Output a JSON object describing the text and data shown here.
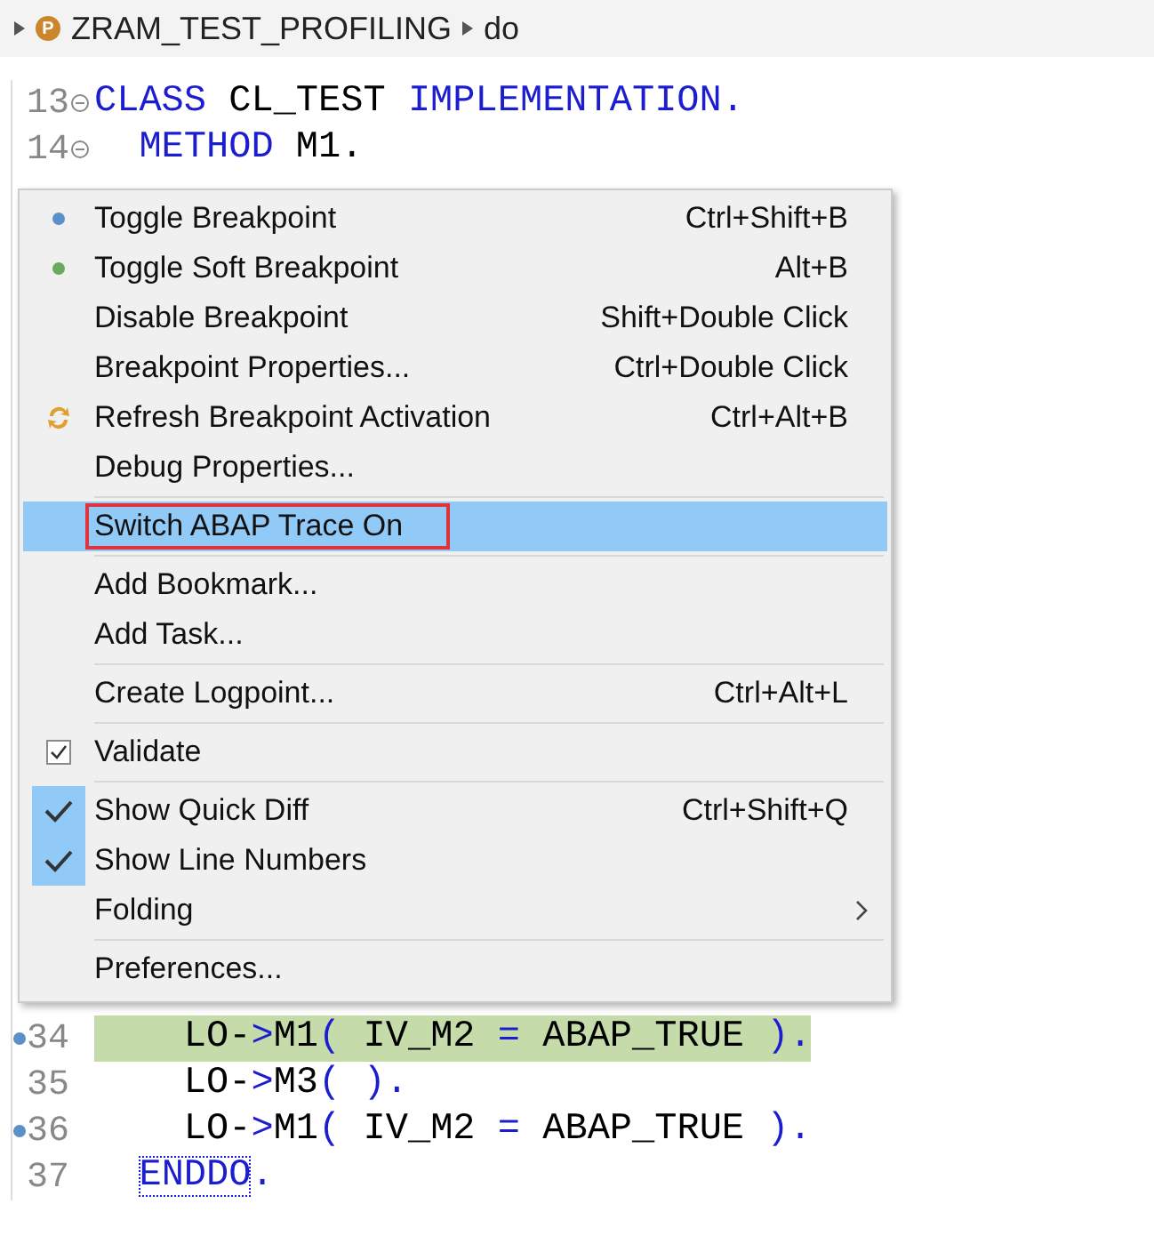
{
  "breadcrumb": {
    "badge": "P",
    "items": [
      "ZRAM_TEST_PROFILING",
      "do"
    ]
  },
  "editor": {
    "top_lines": [
      {
        "number": "13",
        "fold": true,
        "tokens": [
          {
            "kind": "keyword",
            "text": "CLASS "
          },
          {
            "kind": "plain",
            "text": "CL_TEST "
          },
          {
            "kind": "keyword",
            "text": "IMPLEMENTATION."
          }
        ]
      },
      {
        "number": "14",
        "fold": true,
        "tokens": [
          {
            "kind": "keyword",
            "text": "  METHOD "
          },
          {
            "kind": "plain",
            "text": "M1."
          }
        ]
      }
    ],
    "bottom_lines": [
      {
        "number": "34",
        "breakpoint": true,
        "current": true,
        "tokens": [
          {
            "kind": "plain",
            "text": "    LO-"
          },
          {
            "kind": "keyword",
            "text": ">"
          },
          {
            "kind": "plain",
            "text": "M1"
          },
          {
            "kind": "keyword",
            "text": "( "
          },
          {
            "kind": "plain",
            "text": "IV_M2 "
          },
          {
            "kind": "keyword",
            "text": "= "
          },
          {
            "kind": "plain",
            "text": "ABAP_TRUE "
          },
          {
            "kind": "keyword",
            "text": ")."
          }
        ]
      },
      {
        "number": "35",
        "tokens": [
          {
            "kind": "plain",
            "text": "    LO-"
          },
          {
            "kind": "keyword",
            "text": ">"
          },
          {
            "kind": "plain",
            "text": "M3"
          },
          {
            "kind": "keyword",
            "text": "( )."
          }
        ]
      },
      {
        "number": "36",
        "breakpoint": true,
        "tokens": [
          {
            "kind": "plain",
            "text": "    LO-"
          },
          {
            "kind": "keyword",
            "text": ">"
          },
          {
            "kind": "plain",
            "text": "M1"
          },
          {
            "kind": "keyword",
            "text": "( "
          },
          {
            "kind": "plain",
            "text": "IV_M2 "
          },
          {
            "kind": "keyword",
            "text": "= "
          },
          {
            "kind": "plain",
            "text": "ABAP_TRUE "
          },
          {
            "kind": "keyword",
            "text": ")."
          }
        ]
      },
      {
        "number": "37",
        "tokens": [
          {
            "kind": "bracket-match",
            "text": "  ENDDO"
          },
          {
            "kind": "keyword",
            "text": "."
          }
        ]
      }
    ]
  },
  "context_menu": {
    "items": [
      {
        "kind": "dot-action",
        "color": "#5b8fc7",
        "label": "Toggle Breakpoint",
        "shortcut": "Ctrl+Shift+B",
        "selected": false
      },
      {
        "kind": "dot-action",
        "color": "#6aaa5a",
        "label": "Toggle Soft Breakpoint",
        "shortcut": "Alt+B",
        "selected": false
      },
      {
        "kind": "action",
        "label": "Disable Breakpoint",
        "shortcut": "Shift+Double Click",
        "selected": false
      },
      {
        "kind": "action",
        "label": "Breakpoint Properties...",
        "shortcut": "Ctrl+Double Click",
        "selected": false
      },
      {
        "kind": "refresh-action",
        "label": "Refresh Breakpoint Activation",
        "shortcut": "Ctrl+Alt+B",
        "selected": false
      },
      {
        "kind": "action",
        "label": "Debug Properties...",
        "selected": false
      },
      {
        "kind": "separator"
      },
      {
        "kind": "action",
        "label": "Switch ABAP Trace On",
        "selected": true,
        "outlined": true
      },
      {
        "kind": "separator"
      },
      {
        "kind": "action",
        "label": "Add Bookmark...",
        "selected": false
      },
      {
        "kind": "action",
        "label": "Add Task...",
        "selected": false
      },
      {
        "kind": "separator"
      },
      {
        "kind": "action",
        "label": "Create Logpoint...",
        "shortcut": "Ctrl+Alt+L",
        "selected": false
      },
      {
        "kind": "separator"
      },
      {
        "kind": "checkbox",
        "label": "Validate",
        "checked": true,
        "selected": false
      },
      {
        "kind": "separator"
      },
      {
        "kind": "toggle",
        "label": "Show Quick Diff",
        "shortcut": "Ctrl+Shift+Q",
        "checked": true,
        "selected": false
      },
      {
        "kind": "toggle",
        "label": "Show Line Numbers",
        "checked": true,
        "selected": false
      },
      {
        "kind": "submenu",
        "label": "Folding",
        "selected": false
      },
      {
        "kind": "separator"
      },
      {
        "kind": "action",
        "label": "Preferences...",
        "selected": false
      }
    ]
  }
}
